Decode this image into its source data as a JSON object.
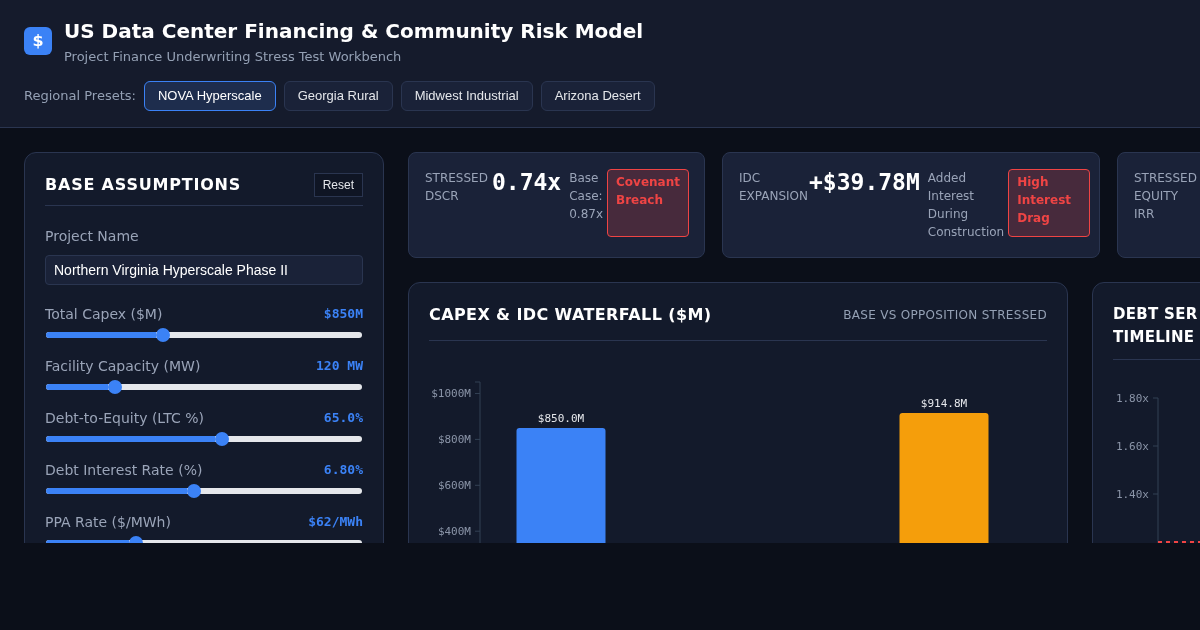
{
  "header": {
    "logo_glyph": "$",
    "title": "US Data Center Financing & Community Risk Model",
    "subtitle": "Project Finance Underwriting Stress Test Workbench"
  },
  "presets": {
    "label": "Regional Presets:",
    "items": [
      {
        "label": "NOVA Hyperscale",
        "selected": true
      },
      {
        "label": "Georgia Rural",
        "selected": false
      },
      {
        "label": "Midwest Industrial",
        "selected": false
      },
      {
        "label": "Arizona Desert",
        "selected": false
      }
    ]
  },
  "assumptions": {
    "title": "BASE ASSUMPTIONS",
    "reset": "Reset",
    "project_name_label": "Project Name",
    "project_name": "Northern Virginia Hyperscale Phase II",
    "sliders": [
      {
        "label": "Total Capex ($M)",
        "reading": "$850M",
        "level": 0.37
      },
      {
        "label": "Facility Capacity (MW)",
        "reading": "120 MW",
        "level": 0.22
      },
      {
        "label": "Debt-to-Equity (LTC %)",
        "reading": "65.0%",
        "level": 0.556
      },
      {
        "label": "Debt Interest Rate (%)",
        "reading": "6.80%",
        "level": 0.47
      },
      {
        "label": "PPA Rate ($/MWh)",
        "reading": "$62/MWh",
        "level": 0.286
      }
    ]
  },
  "kpis": [
    {
      "label": "STRESSED DSCR",
      "value": "0.74x",
      "note": "Base Case: 0.87x",
      "badge": "Covenant Breach"
    },
    {
      "label": "IDC EXPANSION",
      "value": "+$39.78M",
      "note": "Added Interest During Construction",
      "badge": "High Interest Drag"
    },
    {
      "label": "STRESSED EQUITY IRR"
    }
  ],
  "waterfall": {
    "title": "CAPEX & IDC WATERFALL ($M)",
    "subtitle": "BASE VS OPPOSITION STRESSED",
    "chart_data": {
      "type": "bar",
      "categories": [
        null,
        null
      ],
      "values": [
        850,
        914.8
      ],
      "colors": [
        "#3b82f6",
        "#f59e0b"
      ],
      "ylim": [
        0,
        1050
      ],
      "yticks": [
        {
          "value": 400,
          "label": "$400M"
        },
        {
          "value": 600,
          "label": "$600M"
        },
        {
          "value": 800,
          "label": "$800M"
        },
        {
          "value": 1000,
          "label": "$1000M"
        }
      ],
      "value_labels": [
        "$850.0M",
        "$914.8M"
      ]
    }
  },
  "timeline": {
    "title": "DEBT SER",
    "title_line_2": "TIMELINE",
    "axis_labels": [
      "1.80x",
      "1.60x",
      "1.40x"
    ]
  }
}
